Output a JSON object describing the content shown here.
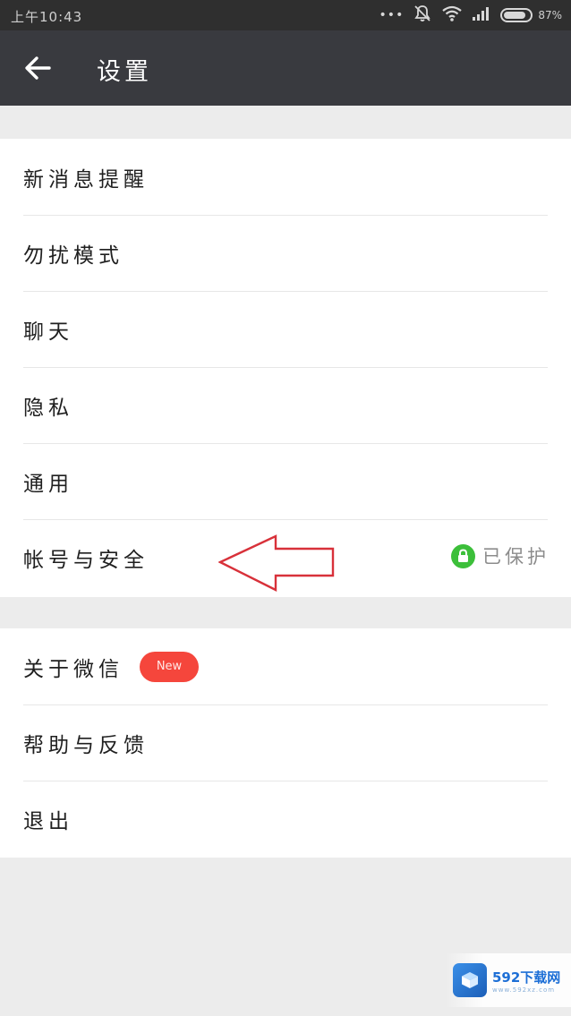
{
  "status_bar": {
    "time": "上午10:43",
    "dots": "•••",
    "battery_percent": "87%",
    "battery_level": 0.87
  },
  "app_bar": {
    "title": "设置"
  },
  "group_1": {
    "items": [
      {
        "label": "新消息提醒"
      },
      {
        "label": "勿扰模式"
      },
      {
        "label": "聊天"
      },
      {
        "label": "隐私"
      },
      {
        "label": "通用"
      },
      {
        "label": "帐号与安全",
        "status": "已保护"
      }
    ]
  },
  "group_2": {
    "items": [
      {
        "label": "关于微信",
        "badge": "New"
      },
      {
        "label": "帮助与反馈"
      },
      {
        "label": "退出"
      }
    ]
  },
  "watermark": {
    "main": "592下载网",
    "sub": "www.592xz.com"
  },
  "colors": {
    "app_bar": "#393a3f",
    "status_bar": "#2f2f2f",
    "badge_red": "#f5463c",
    "lock_green": "#3cbf3a",
    "arrow_red": "#d8313a"
  },
  "icons": {
    "back": "arrow-left-icon",
    "lock": "lock-icon",
    "wifi": "wifi-icon",
    "signal": "signal-icon",
    "dnd": "notifications-off-icon",
    "battery": "battery-icon"
  }
}
